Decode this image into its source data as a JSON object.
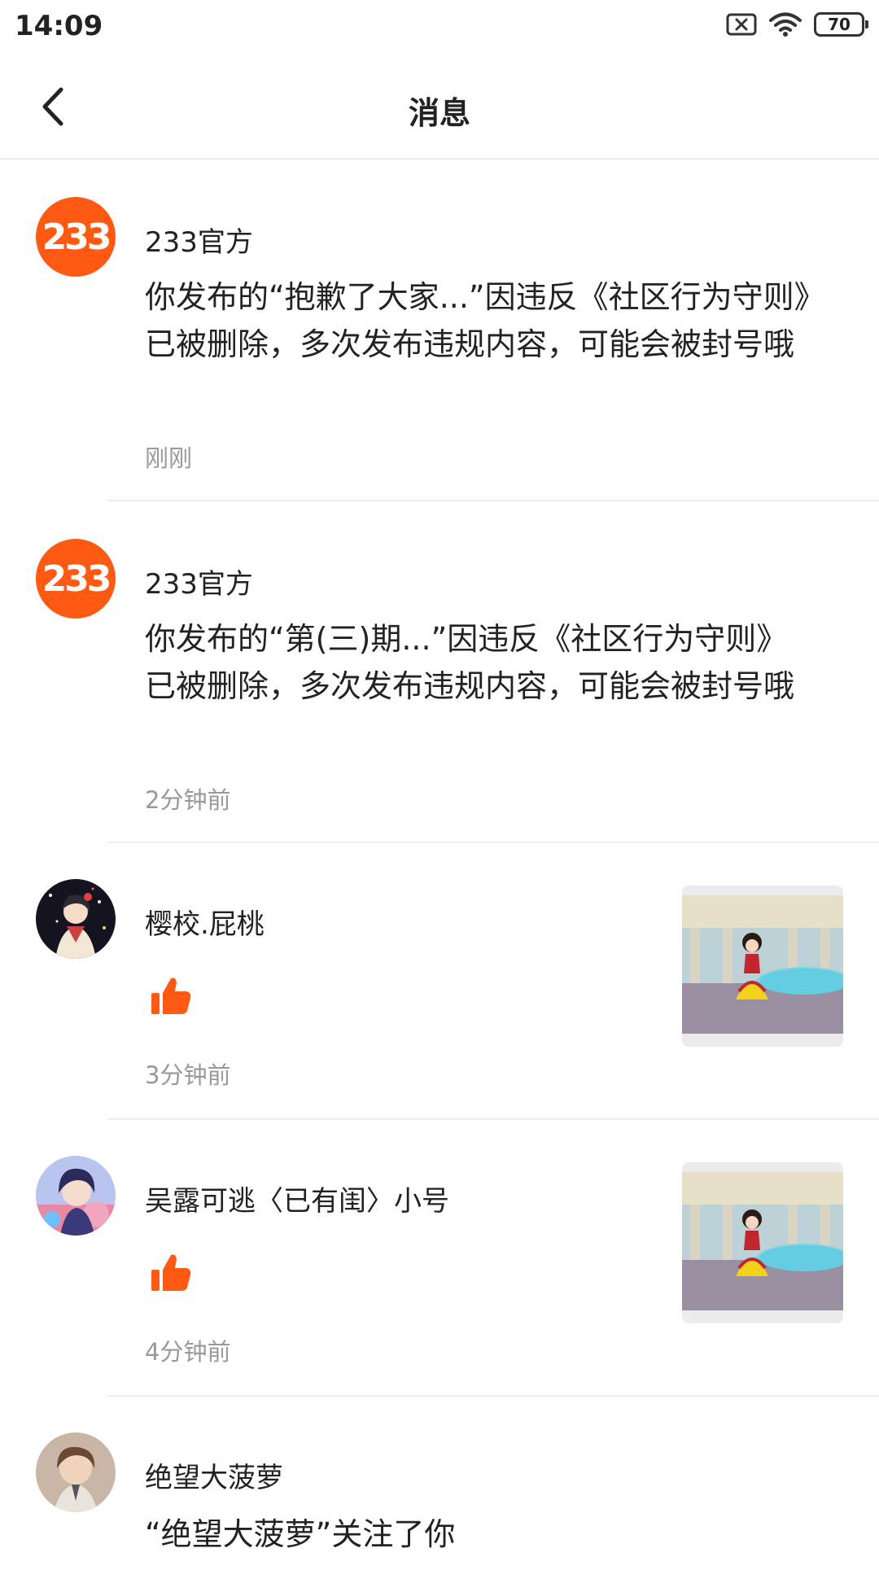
{
  "status_bar": {
    "time": "14:09",
    "battery": "70",
    "icons": [
      "sim-missing-icon",
      "wifi-icon",
      "battery-icon"
    ]
  },
  "header": {
    "title": "消息",
    "back_icon": "chevron-left-icon"
  },
  "colors": {
    "brand": "#ff5a14",
    "timestamp": "#999999",
    "divider": "#eeeeee"
  },
  "messages": [
    {
      "sender": "233官方",
      "avatar_text": "233",
      "body": "你发布的“抱歉了大家...”因违反《社区行为守则》已被删除，多次发布违规内容，可能会被封号哦",
      "time": "刚刚"
    },
    {
      "sender": "233官方",
      "avatar_text": "233",
      "body": "你发布的“第(三)期...”因违反《社区行为守则》已被删除，多次发布违规内容，可能会被封号哦",
      "time": "2分钟前"
    },
    {
      "sender": "樱校.屁桃",
      "action_icon": "thumbs-up-icon",
      "time": "3分钟前"
    },
    {
      "sender": "吴露可逃〈已有闺〉小号",
      "action_icon": "thumbs-up-icon",
      "time": "4分钟前"
    },
    {
      "sender": "绝望大菠萝",
      "body": "“绝望大菠萝”关注了你"
    }
  ]
}
